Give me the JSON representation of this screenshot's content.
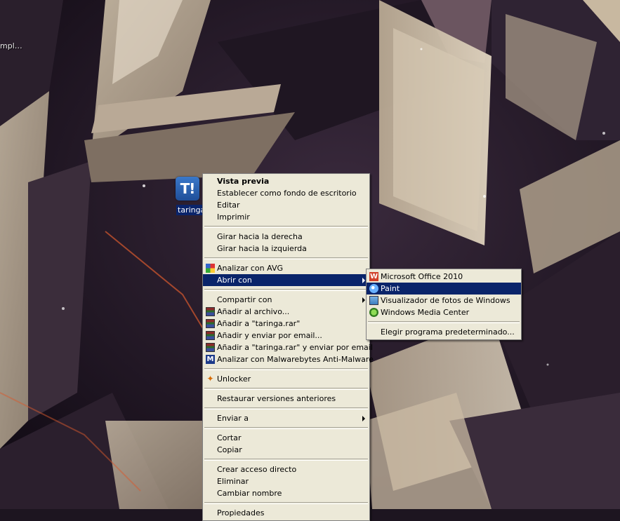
{
  "desktop": {
    "truncated_label": "mpl…",
    "icon": {
      "glyph": "T!",
      "label": "taringa"
    }
  },
  "context_menu": {
    "items": [
      {
        "label": "Vista previa"
      },
      {
        "label": "Establecer como fondo de escritorio"
      },
      {
        "label": "Editar"
      },
      {
        "label": "Imprimir"
      },
      {
        "label": "Girar hacia la derecha"
      },
      {
        "label": "Girar hacia la izquierda"
      },
      {
        "label": "Analizar con AVG"
      },
      {
        "label": "Abrir con"
      },
      {
        "label": "Compartir con"
      },
      {
        "label": "Añadir al archivo..."
      },
      {
        "label": "Añadir a \"taringa.rar\""
      },
      {
        "label": "Añadir y enviar por email..."
      },
      {
        "label": "Añadir a \"taringa.rar\" y enviar por email"
      },
      {
        "label": "Analizar con Malwarebytes Anti-Malware"
      },
      {
        "label": "Unlocker"
      },
      {
        "label": "Restaurar versiones anteriores"
      },
      {
        "label": "Enviar a"
      },
      {
        "label": "Cortar"
      },
      {
        "label": "Copiar"
      },
      {
        "label": "Crear acceso directo"
      },
      {
        "label": "Eliminar"
      },
      {
        "label": "Cambiar nombre"
      },
      {
        "label": "Propiedades"
      }
    ]
  },
  "open_with_submenu": {
    "items": [
      {
        "label": "Microsoft Office 2010"
      },
      {
        "label": "Paint"
      },
      {
        "label": "Visualizador de fotos de Windows"
      },
      {
        "label": "Windows Media Center"
      },
      {
        "label": "Elegir programa predeterminado..."
      }
    ]
  },
  "colors": {
    "highlight": "#0a246a",
    "menu_bg": "#ece9d8"
  }
}
